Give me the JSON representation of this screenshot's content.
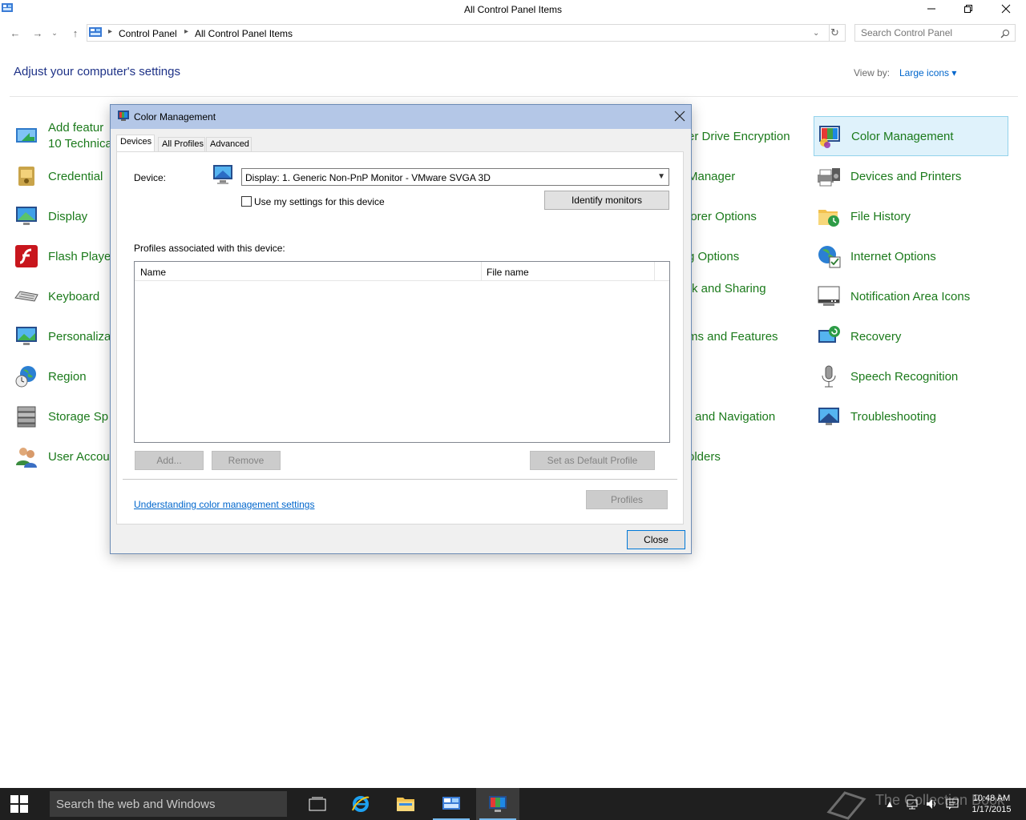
{
  "window": {
    "title": "All Control Panel Items"
  },
  "address": {
    "crumbs": [
      "Control Panel",
      "All Control Panel Items"
    ],
    "search_placeholder": "Search Control Panel"
  },
  "content": {
    "heading": "Adjust your computer's settings",
    "view_by_label": "View by:",
    "view_by_value": "Large icons ▾"
  },
  "items_left": [
    {
      "label_line1": "Add featur",
      "label_line2": "10 Technica",
      "icon": "add-features-icon"
    },
    {
      "label": "Credential",
      "icon": "credential-manager-icon"
    },
    {
      "label": "Display",
      "icon": "display-icon"
    },
    {
      "label": "Flash Playe",
      "icon": "flash-player-icon"
    },
    {
      "label": "Keyboard",
      "icon": "keyboard-icon"
    },
    {
      "label": "Personaliza",
      "icon": "personalization-icon"
    },
    {
      "label": "Region",
      "icon": "region-icon"
    },
    {
      "label": "Storage Sp",
      "icon": "storage-spaces-icon"
    },
    {
      "label": "User Accou",
      "icon": "user-accounts-icon"
    }
  ],
  "items_middle": [
    {
      "label": "er Drive Encryption"
    },
    {
      "label": "Manager"
    },
    {
      "label": "lorer Options"
    },
    {
      "label": "g Options"
    },
    {
      "label": "rk and Sharing"
    },
    {
      "label": "ms and Features"
    },
    {
      "label": "r and Navigation"
    },
    {
      "label": "olders"
    }
  ],
  "items_right": [
    {
      "label": "Color Management",
      "icon": "color-management-icon",
      "selected": true
    },
    {
      "label": "Devices and Printers",
      "icon": "devices-printers-icon"
    },
    {
      "label": "File History",
      "icon": "file-history-icon"
    },
    {
      "label": "Internet Options",
      "icon": "internet-options-icon"
    },
    {
      "label": "Notification Area Icons",
      "icon": "notification-area-icon"
    },
    {
      "label": "Recovery",
      "icon": "recovery-icon"
    },
    {
      "label": "Speech Recognition",
      "icon": "speech-recognition-icon"
    },
    {
      "label": "Troubleshooting",
      "icon": "troubleshooting-icon"
    }
  ],
  "dialog": {
    "title": "Color Management",
    "tabs": [
      "Devices",
      "All Profiles",
      "Advanced"
    ],
    "device_label": "Device:",
    "device_value": "Display: 1. Generic Non-PnP Monitor - VMware SVGA 3D",
    "use_my_settings": "Use my settings for this device",
    "identify_monitors": "Identify monitors",
    "profiles_label": "Profiles associated with this device:",
    "columns": [
      "Name",
      "File name"
    ],
    "add": "Add...",
    "remove": "Remove",
    "set_default": "Set as Default Profile",
    "link": "Understanding color management settings",
    "profiles": "Profiles",
    "close": "Close"
  },
  "taskbar": {
    "search_placeholder": "Search the web and Windows",
    "time": "10:48 AM",
    "date": "1/17/2015",
    "watermark": "The Collection Book"
  },
  "colors": {
    "link_green": "#1b7a1b",
    "heading_blue": "#1e3287",
    "dialog_title": "#b4c7e7",
    "taskbar": "#1f1f1f"
  }
}
